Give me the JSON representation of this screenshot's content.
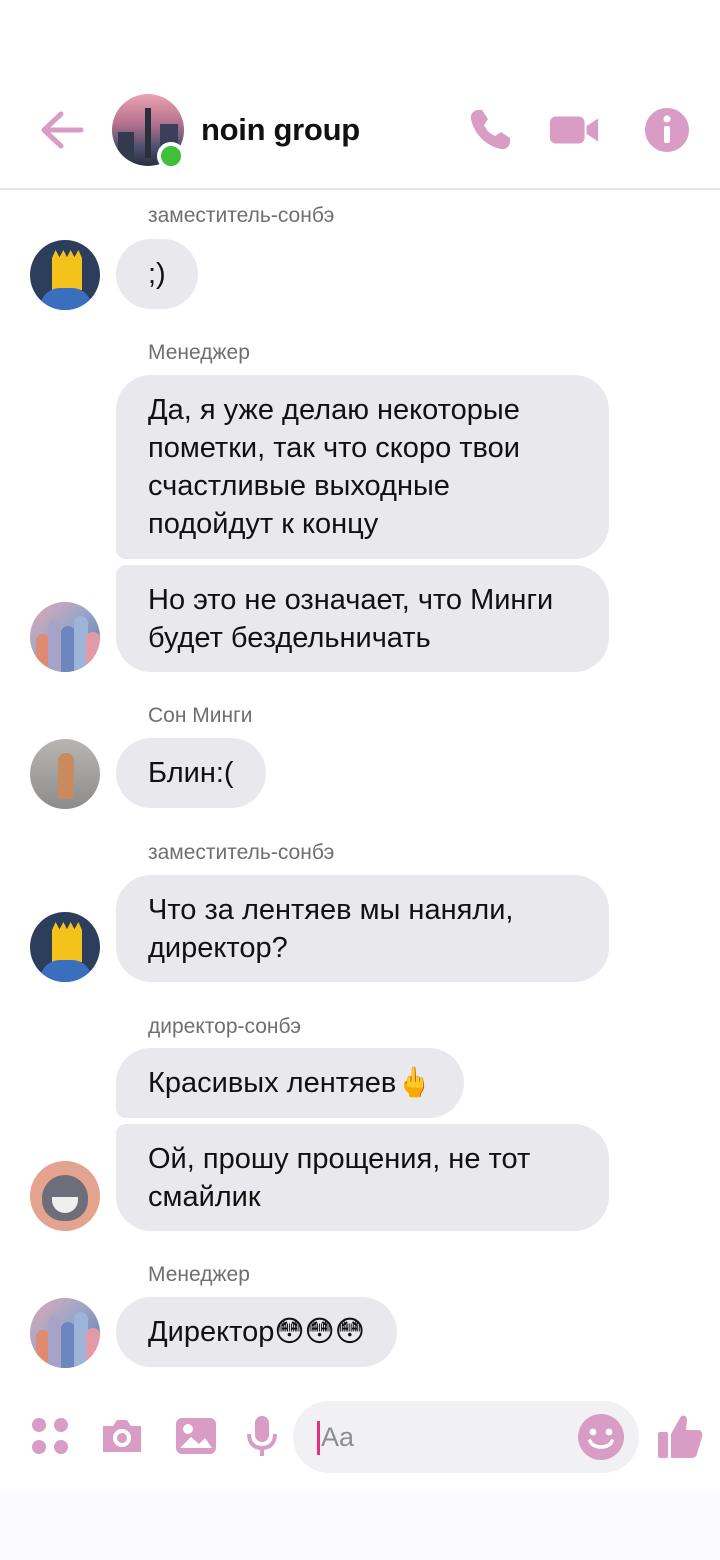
{
  "header": {
    "title": "noin group",
    "online": true,
    "accent_color": "#d99cc4",
    "icons": [
      "back-arrow-icon",
      "phone-icon",
      "video-camera-icon",
      "info-icon"
    ]
  },
  "messages": [
    {
      "sender": "заместитель-сонбэ",
      "texts": [
        ";)"
      ]
    },
    {
      "sender": "Менеджер",
      "texts": [
        "Да, я уже делаю некоторые пометки, так что скоро твои счастливые выходные подойдут к концу",
        "Но это не означает, что Минги будет бездельничать"
      ]
    },
    {
      "sender": "Сон Минги",
      "texts": [
        "Блин:("
      ]
    },
    {
      "sender": "заместитель-сонбэ",
      "texts": [
        "Что за лентяев мы наняли, директор?"
      ]
    },
    {
      "sender": "директор-сонбэ",
      "texts": [
        "Красивых лентяев🖕",
        "Ой, прошу прощения, не тот смайлик"
      ]
    },
    {
      "sender": "Менеджер",
      "texts": [
        "Директор😳😳😳"
      ]
    }
  ],
  "composer": {
    "placeholder": "Aa",
    "icons": [
      "apps-icon",
      "camera-icon",
      "image-icon",
      "microphone-icon",
      "emoji-icon",
      "thumbs-up-icon"
    ]
  }
}
